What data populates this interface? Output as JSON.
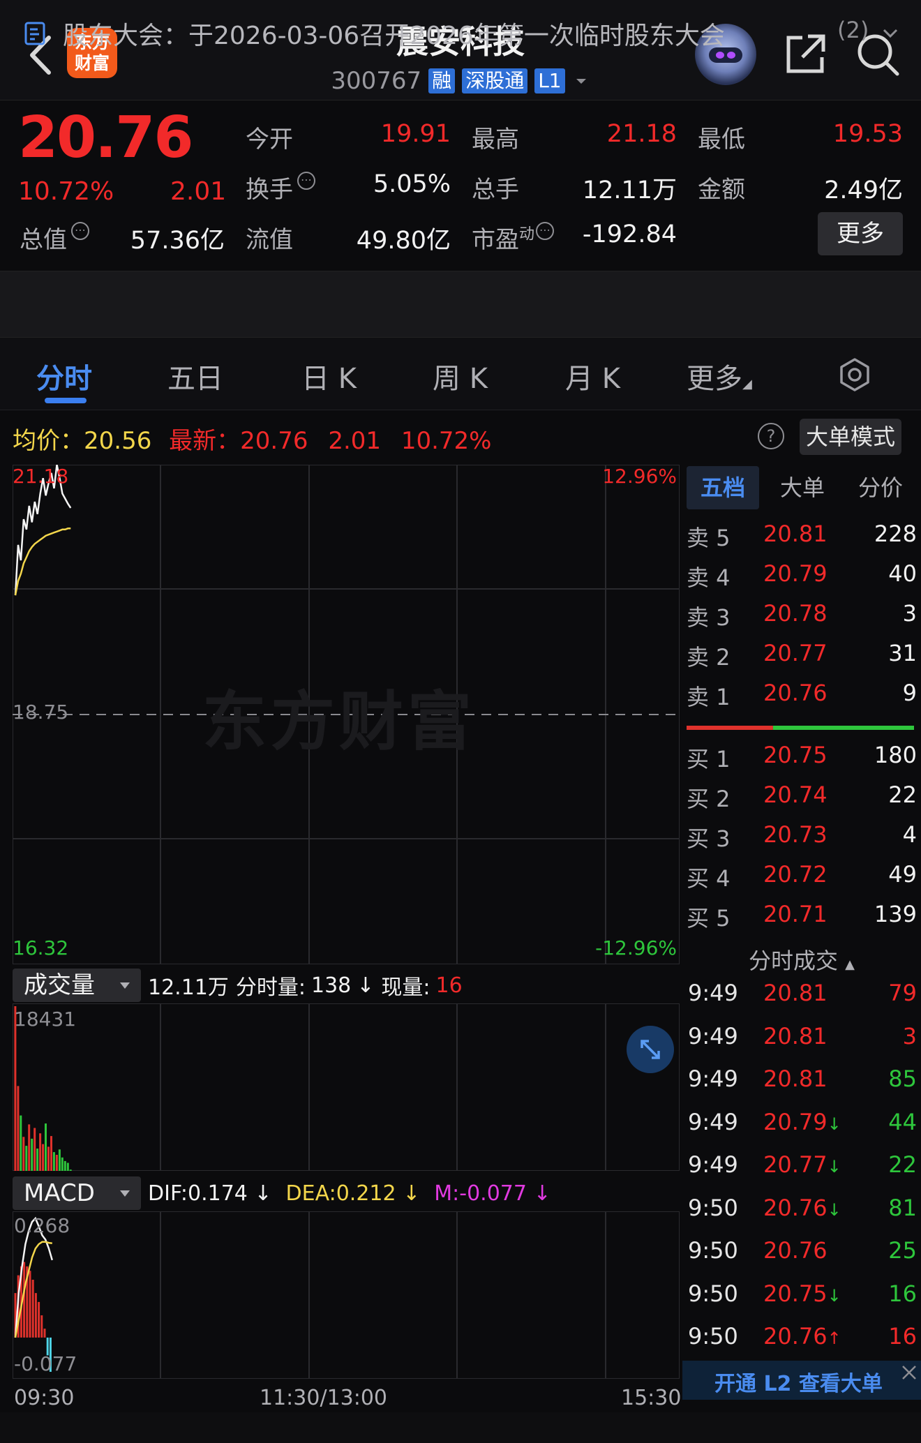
{
  "header": {
    "logo_line1": "东方",
    "logo_line2": "财富",
    "title": "震安科技",
    "code": "300767",
    "tags": [
      "融",
      "深股通",
      "L1"
    ]
  },
  "quote": {
    "price": "20.76",
    "pct": "10.72%",
    "change": "2.01",
    "rows": [
      [
        {
          "label": "今开",
          "value": "19.91",
          "color": "red"
        },
        {
          "label": "最高",
          "value": "21.18",
          "color": "red"
        },
        {
          "label": "最低",
          "value": "19.53",
          "color": "red"
        }
      ],
      [
        {
          "label": "换手",
          "value": "5.05%",
          "color": "white"
        },
        {
          "label": "总手",
          "value": "12.11万",
          "color": "white"
        },
        {
          "label": "金额",
          "value": "2.49亿",
          "color": "white"
        }
      ]
    ],
    "total_value_label": "总值",
    "total_value": "57.36亿",
    "float_value_label": "流值",
    "float_value": "49.80亿",
    "pe_label": "市盈",
    "pe_sup": "动",
    "pe_value": "-192.84",
    "more_label": "更多"
  },
  "notice": {
    "text": "股东大会：于2026-03-06召开2026年第一次临时股东大会",
    "count": "(2)"
  },
  "tabs": [
    "分时",
    "五日",
    "日 K",
    "周 K",
    "月 K",
    "更多"
  ],
  "avg_row": {
    "avg_label": "均价：",
    "avg_value": "20.56",
    "latest_label": "最新：",
    "latest_value": "20.76",
    "change": "2.01",
    "pct": "10.72%",
    "help": "?",
    "big_mode": "大单模式"
  },
  "main_chart": {
    "y_top": "21.18",
    "y_mid": "18.75",
    "y_bottom": "16.32",
    "pct_top": "12.96%",
    "pct_bottom": "-12.96%",
    "watermark": "东方财富"
  },
  "volume": {
    "selector": "成交量",
    "total": "12.11万",
    "minute_label": "分时量:",
    "minute_value": "138",
    "arrow": "↓",
    "current_label": "现量:",
    "current_value": "16",
    "y_top": "18431"
  },
  "macd": {
    "selector": "MACD",
    "dif": "DIF:0.174 ↓",
    "dea": "DEA:0.212 ↓",
    "m": "M:-0.077 ↓",
    "y_top": "0.268",
    "y_bottom": "-0.077"
  },
  "time_axis": [
    "09:30",
    "11:30/13:00",
    "15:30"
  ],
  "chart_data": {
    "type": "line",
    "title": "",
    "x": [
      "09:30",
      "09:31",
      "09:32",
      "09:33",
      "09:34",
      "09:35",
      "09:36",
      "09:37",
      "09:38",
      "09:39",
      "09:40",
      "09:41",
      "09:42",
      "09:43",
      "09:44",
      "09:45",
      "09:46",
      "09:47",
      "09:48",
      "09:49",
      "09:50"
    ],
    "series": [
      {
        "values": [
          19.91,
          20.4,
          20.25,
          20.65,
          20.55,
          20.78,
          20.62,
          20.82,
          20.7,
          20.9,
          21.05,
          20.88,
          21.0,
          21.1,
          20.95,
          21.18,
          21.05,
          20.9,
          20.85,
          20.8,
          20.76
        ]
      },
      {
        "values": [
          19.91,
          20.05,
          20.12,
          20.22,
          20.28,
          20.34,
          20.38,
          20.41,
          20.43,
          20.45,
          20.47,
          20.49,
          20.5,
          20.51,
          20.52,
          20.53,
          20.54,
          20.55,
          20.55,
          20.56,
          20.56
        ]
      }
    ],
    "ylim": [
      16.32,
      21.18
    ],
    "volumes": [
      18431,
      9500,
      6200,
      3800,
      2800,
      5200,
      3600,
      4800,
      2500,
      4200,
      3000,
      5300,
      2700,
      3900,
      2100,
      1800,
      2400,
      1500,
      1100,
      900,
      138
    ],
    "volume_ylim": [
      0,
      18431
    ],
    "macd": {
      "dif": [
        0.0,
        0.1,
        0.16,
        0.21,
        0.24,
        0.26,
        0.268,
        0.25,
        0.23,
        0.22,
        0.2,
        0.174
      ],
      "dea": [
        0.0,
        0.04,
        0.08,
        0.12,
        0.15,
        0.18,
        0.2,
        0.21,
        0.215,
        0.215,
        0.213,
        0.212
      ],
      "hist": [
        0.1,
        0.14,
        0.16,
        0.17,
        0.16,
        0.15,
        0.13,
        0.1,
        0.08,
        0.05,
        0.02,
        -0.04,
        -0.077
      ],
      "ylim": [
        -0.077,
        0.268
      ]
    }
  },
  "orderbook": {
    "tabs": [
      "五档",
      "大单",
      "分价"
    ],
    "asks": [
      {
        "label": "卖 5",
        "price": "20.81",
        "vol": "228"
      },
      {
        "label": "卖 4",
        "price": "20.79",
        "vol": "40"
      },
      {
        "label": "卖 3",
        "price": "20.78",
        "vol": "3"
      },
      {
        "label": "卖 2",
        "price": "20.77",
        "vol": "31"
      },
      {
        "label": "卖 1",
        "price": "20.76",
        "vol": "9"
      }
    ],
    "bids": [
      {
        "label": "买 1",
        "price": "20.75",
        "vol": "180"
      },
      {
        "label": "买 2",
        "price": "20.74",
        "vol": "22"
      },
      {
        "label": "买 3",
        "price": "20.73",
        "vol": "4"
      },
      {
        "label": "买 4",
        "price": "20.72",
        "vol": "49"
      },
      {
        "label": "买 5",
        "price": "20.71",
        "vol": "139"
      }
    ],
    "ask_ratio": 0.38
  },
  "ticks": {
    "header": "分时成交",
    "rows": [
      {
        "time": "9:49",
        "price": "20.81",
        "arrow": "",
        "vol": "79",
        "color": "red"
      },
      {
        "time": "9:49",
        "price": "20.81",
        "arrow": "",
        "vol": "3",
        "color": "red"
      },
      {
        "time": "9:49",
        "price": "20.81",
        "arrow": "",
        "vol": "85",
        "color": "green"
      },
      {
        "time": "9:49",
        "price": "20.79",
        "arrow": "↓",
        "vol": "44",
        "color": "green"
      },
      {
        "time": "9:49",
        "price": "20.77",
        "arrow": "↓",
        "vol": "22",
        "color": "green"
      },
      {
        "time": "9:50",
        "price": "20.76",
        "arrow": "↓",
        "vol": "81",
        "color": "green"
      },
      {
        "time": "9:50",
        "price": "20.76",
        "arrow": "",
        "vol": "25",
        "color": "green"
      },
      {
        "time": "9:50",
        "price": "20.75",
        "arrow": "↓",
        "vol": "16",
        "color": "green"
      },
      {
        "time": "9:50",
        "price": "20.76",
        "arrow": "↑",
        "vol": "16",
        "color": "red"
      }
    ],
    "l2_label": "开通 L2 查看大单"
  }
}
